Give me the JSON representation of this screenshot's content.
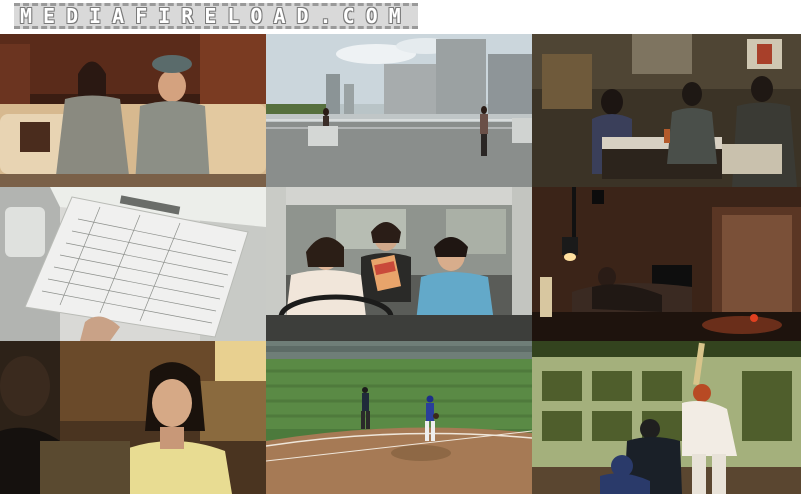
{
  "watermark": {
    "text": "MEDIAFIRELOAD.COM"
  },
  "thumbnails": [
    {
      "scene": "living-room"
    },
    {
      "scene": "rooftop"
    },
    {
      "scene": "restaurant"
    },
    {
      "scene": "document"
    },
    {
      "scene": "car-interior"
    },
    {
      "scene": "dark-room"
    },
    {
      "scene": "woman-portrait"
    },
    {
      "scene": "baseball-field"
    },
    {
      "scene": "batter"
    }
  ]
}
